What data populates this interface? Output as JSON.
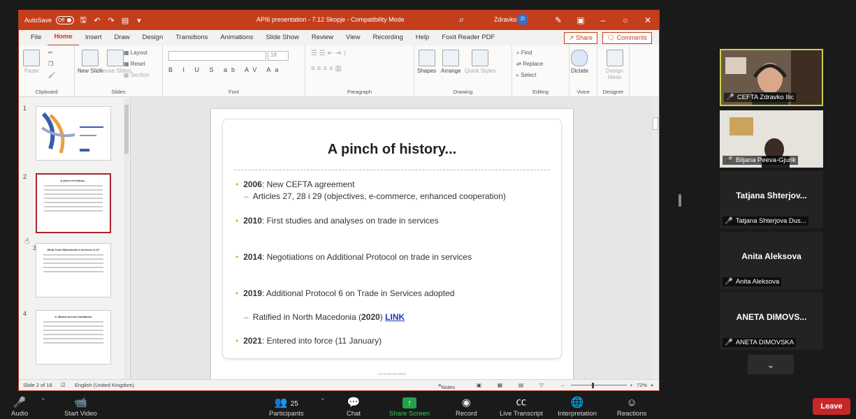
{
  "ppt": {
    "autosave_label": "AutoSave",
    "autosave_state": "Off",
    "doc_title": "API6 presentation - 7.12 Skopje  -  Compatibility Mode",
    "user_name": "Zdravko Ilic",
    "user_initials": "ZI",
    "tabs": [
      "File",
      "Home",
      "Insert",
      "Draw",
      "Design",
      "Transitions",
      "Animations",
      "Slide Show",
      "Review",
      "View",
      "Recording",
      "Help",
      "Foxit Reader PDF"
    ],
    "active_tab": "Home",
    "share_label": "Share",
    "comments_label": "Comments",
    "ribbon": {
      "clipboard": {
        "label": "Clipboard",
        "paste": "Paste"
      },
      "slides": {
        "label": "Slides",
        "new_slide": "New Slide",
        "reuse_slides": "Reuse Slides",
        "layout": "Layout",
        "reset": "Reset",
        "section": "Section"
      },
      "font": {
        "label": "Font",
        "format_buttons": "B I U S ab AV Aa"
      },
      "paragraph": {
        "label": "Paragraph"
      },
      "drawing": {
        "label": "Drawing",
        "shapes": "Shapes",
        "arrange": "Arrange",
        "quick_styles": "Quick Styles"
      },
      "editing": {
        "label": "Editing",
        "find": "Find",
        "replace": "Replace",
        "select": "Select"
      },
      "voice": {
        "label": "Voice",
        "dictate": "Dictate"
      },
      "designer": {
        "label": "Designer",
        "design_ideas": "Design Ideas"
      }
    },
    "thumbnails": [
      {
        "num": "1"
      },
      {
        "num": "2",
        "title": "A pinch of history..."
      },
      {
        "num": "3",
        "title": "What Code Macedonia in services is it?"
      },
      {
        "num": "4",
        "title": "II. Market access limitations"
      }
    ],
    "slide": {
      "title": "A pinch of history...",
      "bullets": [
        {
          "year": "2006",
          "text": ": New CEFTA agreement"
        },
        {
          "year": "2010",
          "text": ": First studies and analyses on trade in services"
        },
        {
          "year": "2014",
          "text": ": Negotiations on Additional Protocol on trade in services"
        },
        {
          "year": "2019",
          "text": ": Additional Protocol 6 on Trade in Services adopted"
        },
        {
          "year": "2021",
          "text": ": Entered into force (11 January)"
        }
      ],
      "sub1": "Articles 27, 28 i 29 (objectives, e-commerce, enhanced cooperation)",
      "sub2_prefix": "Ratified in North Macedonia (",
      "sub2_year": "2020",
      "sub2_suffix": ") ",
      "sub2_link": "LINK",
      "footer": "CEFTA SECRETARIAT"
    },
    "status": {
      "slide_count": "Slide 2 of 18",
      "language": "English (United Kingdom)",
      "notes": "Notes",
      "zoom": "72%"
    }
  },
  "zoom": {
    "participants": [
      {
        "label": "CEFTA Zdravko Ilic",
        "video": true,
        "active": true
      },
      {
        "label": "Biljana Peeva-Gjurik",
        "video": true,
        "active": false
      },
      {
        "name": "Tatjana  Shterjov...",
        "label": "Tatjana Shterjova Dus...",
        "video": false
      },
      {
        "name": "Anita Aleksova",
        "label": "Anita Aleksova",
        "video": false
      },
      {
        "name": "ANETA  DIMOVS...",
        "label": "ANETA DIMOVSKA",
        "video": false
      }
    ],
    "toolbar": {
      "audio": "Audio",
      "start_video": "Start Video",
      "participants": "Participants",
      "participants_count": "25",
      "chat": "Chat",
      "share_screen": "Share Screen",
      "record": "Record",
      "live_transcript": "Live Transcript",
      "interpretation": "Interpretation",
      "reactions": "Reactions",
      "leave": "Leave"
    }
  }
}
